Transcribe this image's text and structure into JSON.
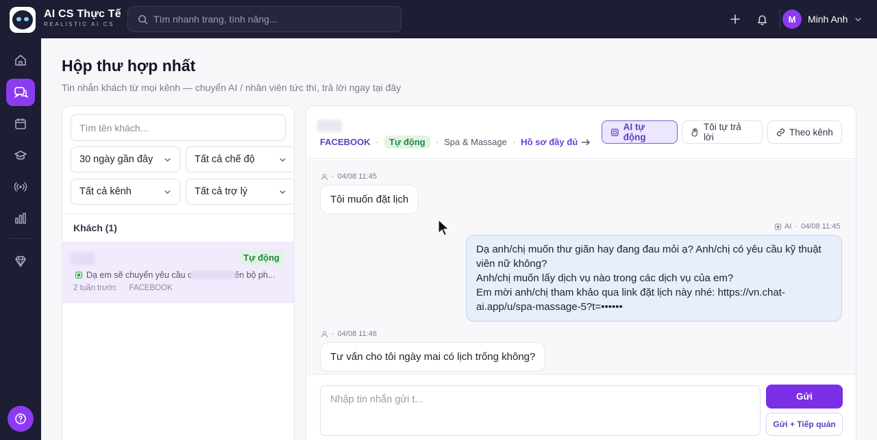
{
  "app": {
    "brand_title": "AI CS Thực Tế",
    "brand_subtitle": "REALISTIC AI CS",
    "search_placeholder": "Tìm nhanh trang, tính năng...",
    "user_initial": "M",
    "user_name": "Minh Anh",
    "accent_color": "#8b3bf0",
    "sidebar_bg": "#1d1d33"
  },
  "sidebar": {
    "items": [
      {
        "icon": "home-icon",
        "active": false
      },
      {
        "icon": "chat-bubbles-icon",
        "active": true
      },
      {
        "icon": "calendar-icon",
        "active": false
      },
      {
        "icon": "education-cap-icon",
        "active": false
      },
      {
        "icon": "broadcast-icon",
        "active": false
      },
      {
        "icon": "bar-chart-icon",
        "active": false
      },
      {
        "icon": "diamond-icon",
        "active": false
      }
    ],
    "help_icon": "help-icon"
  },
  "page": {
    "title": "Hộp thư hợp nhất",
    "subtitle": "Tin nhắn khách từ mọi kênh — chuyển AI / nhân viên tức thì, trả lời ngay tại đây"
  },
  "inbox": {
    "customer_search_placeholder": "Tìm tên khách...",
    "filters": {
      "date": "30 ngày gần đây",
      "mode": "Tất cả chế độ",
      "channel": "Tất cả kênh",
      "assistant": "Tất cả trợ lý"
    },
    "list_header": "Khách (1)",
    "conversations": [
      {
        "badge": "Tự động",
        "preview_start": "Dạ em sẽ chuyển yêu cầu c",
        "preview_end": "ến bộ ph...",
        "time": "2 tuần trước",
        "channel": "FACEBOOK"
      }
    ]
  },
  "chat": {
    "channel": "FACEBOOK",
    "mode": "Tự động",
    "assistant": "Spa & Massage",
    "profile_link": "Hồ sơ đầy đủ",
    "mode_buttons": {
      "ai": "AI tự động",
      "manual": "Tôi tự trả lời",
      "by_channel": "Theo kênh"
    },
    "messages": [
      {
        "sender": "customer",
        "time": "04/08 11:45",
        "text": "Tôi muốn đặt lịch"
      },
      {
        "sender": "ai",
        "label": "AI",
        "time": "04/08 11:45",
        "lines": [
          "Dạ anh/chị muốn thư giãn hay đang đau mỏi ạ? Anh/chị có yêu cầu kỹ thuật",
          "viên nữ không?",
          "Anh/chị muốn lấy dịch vụ nào trong các dịch vụ của em?",
          "Em mời anh/chị tham khảo qua link đặt lịch này nhé: https://vn.chat-",
          "ai.app/u/spa-massage-5?t=••••••"
        ]
      },
      {
        "sender": "customer",
        "time": "04/08 11:46",
        "text": "Tư vấn cho tôi ngày mai có lịch trống không?"
      }
    ],
    "composer_placeholder": "Nhập tin nhắn gửi t...",
    "send_label": "Gửi",
    "send_takeover_label": "Gửi + Tiếp quản"
  }
}
